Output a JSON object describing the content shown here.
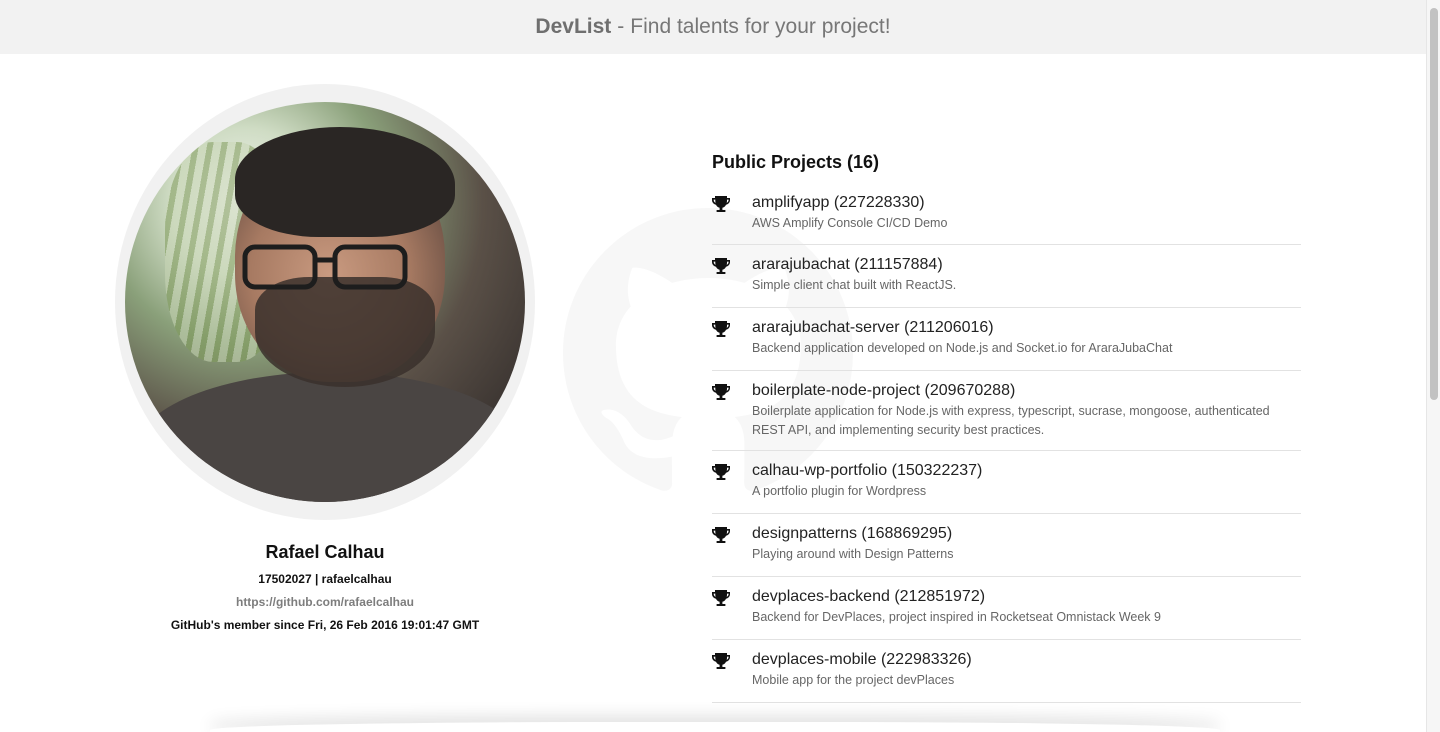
{
  "header": {
    "brand": "DevList",
    "separator": "-",
    "tagline": "Find talents for your project!"
  },
  "profile": {
    "name": "Rafael Calhau",
    "id_login": "17502027 | rafaelcalhau",
    "url": "https://github.com/rafaelcalhau",
    "member_since": "GitHub's member since Fri, 26 Feb 2016 19:01:47 GMT"
  },
  "projects": {
    "heading": "Public Projects (16)",
    "items": [
      {
        "title": "amplifyapp (227228330)",
        "description": "AWS Amplify Console CI/CD Demo"
      },
      {
        "title": "ararajubachat (211157884)",
        "description": "Simple client chat built with ReactJS."
      },
      {
        "title": "ararajubachat-server (211206016)",
        "description": "Backend application developed on Node.js and Socket.io for AraraJubaChat"
      },
      {
        "title": "boilerplate-node-project (209670288)",
        "description": "Boilerplate application for Node.js with express, typescript, sucrase, mongoose, authenticated REST API, and implementing security best practices."
      },
      {
        "title": "calhau-wp-portfolio (150322237)",
        "description": "A portfolio plugin for Wordpress"
      },
      {
        "title": "designpatterns (168869295)",
        "description": "Playing around with Design Patterns"
      },
      {
        "title": "devplaces-backend (212851972)",
        "description": "Backend for DevPlaces, project inspired in Rocketseat Omnistack Week 9"
      },
      {
        "title": "devplaces-mobile (222983326)",
        "description": "Mobile app for the project devPlaces"
      }
    ]
  },
  "icons": {
    "project": "trophy-icon",
    "watermark": "github-octocat-icon"
  },
  "colors": {
    "header_bg": "#f2f2f2",
    "link": "#7d7d7d",
    "divider": "#e2e2e2"
  }
}
